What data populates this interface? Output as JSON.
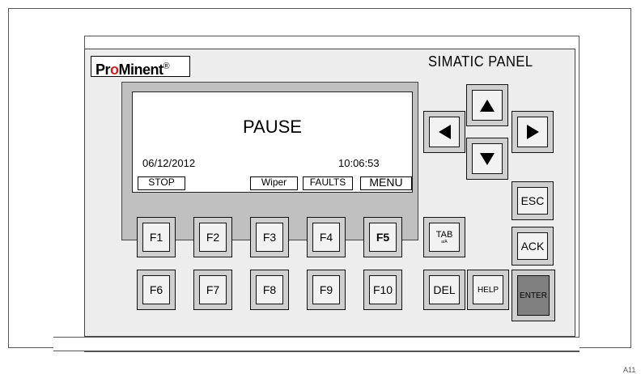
{
  "brand": {
    "logo_prefix": "Pr",
    "logo_o": "o",
    "logo_suffix": "Minent",
    "logo_mark": "®"
  },
  "panel_title": "SIMATIC PANEL",
  "lcd": {
    "status": "PAUSE",
    "date": "06/12/2012",
    "time": "10:06:53",
    "softkeys": [
      "STOP",
      "Wiper",
      "FAULTS",
      "MENU"
    ]
  },
  "function_keys": {
    "row1": [
      "F1",
      "F2",
      "F3",
      "F4",
      "F5"
    ],
    "row2": [
      "F6",
      "F7",
      "F8",
      "F9",
      "F10"
    ]
  },
  "nav_keys": {
    "up": "up-arrow-icon",
    "down": "down-arrow-icon",
    "left": "left-arrow-icon",
    "right": "right-arrow-icon"
  },
  "control_keys": {
    "esc": "ESC",
    "ack": "ACK",
    "tab": "TAB",
    "tab_sub": "a/A",
    "del": "DEL",
    "help": "HELP",
    "enter": "ENTER"
  },
  "colors": {
    "enter_key": "#808080",
    "logo_accent": "#d02020",
    "screen_housing": "#c0c0c0",
    "panel": "#ededed"
  },
  "corner_ref": "A11"
}
